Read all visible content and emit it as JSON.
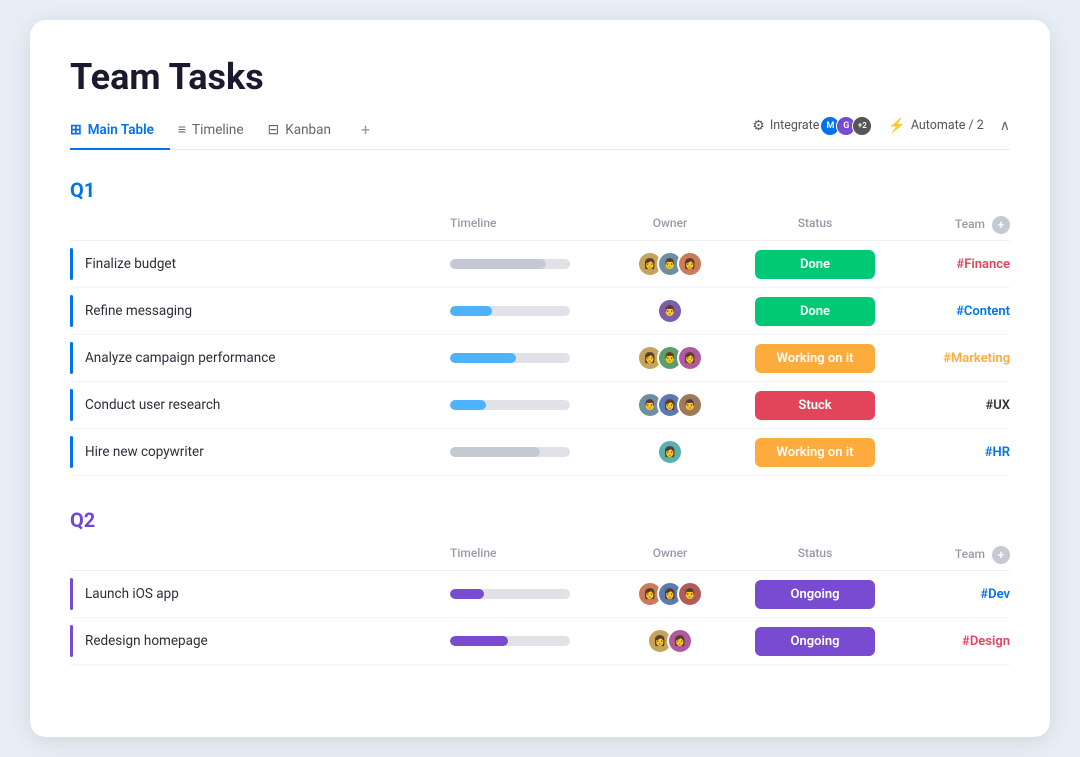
{
  "page": {
    "title": "Team Tasks"
  },
  "tabs": [
    {
      "id": "main-table",
      "label": "Main Table",
      "icon": "⊞",
      "active": true
    },
    {
      "id": "timeline",
      "label": "Timeline",
      "icon": "≡",
      "active": false
    },
    {
      "id": "kanban",
      "label": "Kanban",
      "icon": "⊟",
      "active": false
    },
    {
      "id": "plus",
      "label": "+",
      "active": false
    }
  ],
  "toolbar": {
    "integrate_label": "Integrate",
    "automate_label": "Automate / 2",
    "chevron_label": "^"
  },
  "sections": [
    {
      "id": "q1",
      "label": "Q1",
      "color_class": "q1",
      "columns": {
        "task": "",
        "timeline": "Timeline",
        "owner": "Owner",
        "status": "Status",
        "team": "Team"
      },
      "rows": [
        {
          "id": "finalize-budget",
          "name": "Finalize budget",
          "bar_color": "#0073ea",
          "timeline_fill_pct": 80,
          "timeline_fill_color": "#c5c9d4",
          "timeline_offset": 0,
          "avatars": [
            "av1",
            "av2",
            "av3"
          ],
          "status": "Done",
          "status_class": "status-done",
          "team": "#Finance",
          "team_class": "team-finance"
        },
        {
          "id": "refine-messaging",
          "name": "Refine messaging",
          "bar_color": "#0073ea",
          "timeline_fill_pct": 35,
          "timeline_fill_color": "#4db3ff",
          "timeline_offset": 0,
          "avatars": [
            "av4"
          ],
          "status": "Done",
          "status_class": "status-done",
          "team": "#Content",
          "team_class": "team-content"
        },
        {
          "id": "analyze-campaign",
          "name": "Analyze campaign performance",
          "bar_color": "#0073ea",
          "timeline_fill_pct": 55,
          "timeline_fill_color": "#4db3ff",
          "timeline_offset": 0,
          "avatars": [
            "av1",
            "av5",
            "av6"
          ],
          "status": "Working on it",
          "status_class": "status-working",
          "team": "#Marketing",
          "team_class": "team-marketing"
        },
        {
          "id": "conduct-user-research",
          "name": "Conduct user research",
          "bar_color": "#0073ea",
          "timeline_fill_pct": 30,
          "timeline_fill_color": "#4db3ff",
          "timeline_offset": 0,
          "avatars": [
            "av2",
            "av7",
            "av8"
          ],
          "status": "Stuck",
          "status_class": "status-stuck",
          "team": "#UX",
          "team_class": "team-ux"
        },
        {
          "id": "hire-copywriter",
          "name": "Hire new copywriter",
          "bar_color": "#0073ea",
          "timeline_fill_pct": 75,
          "timeline_fill_color": "#c5c9d4",
          "timeline_offset": 0,
          "avatars": [
            "av9"
          ],
          "status": "Working on it",
          "status_class": "status-working",
          "team": "#HR",
          "team_class": "team-hr"
        }
      ]
    },
    {
      "id": "q2",
      "label": "Q2",
      "color_class": "q2",
      "columns": {
        "task": "",
        "timeline": "Timeline",
        "owner": "Owner",
        "status": "Status",
        "team": "Team"
      },
      "rows": [
        {
          "id": "launch-ios",
          "name": "Launch iOS app",
          "bar_color": "#784bd1",
          "timeline_fill_pct": 28,
          "timeline_fill_color": "#784bd1",
          "timeline_offset": 0,
          "avatars": [
            "av3",
            "av7",
            "av10"
          ],
          "status": "Ongoing",
          "status_class": "status-ongoing",
          "team": "#Dev",
          "team_class": "team-dev"
        },
        {
          "id": "redesign-homepage",
          "name": "Redesign homepage",
          "bar_color": "#784bd1",
          "timeline_fill_pct": 48,
          "timeline_fill_color": "#784bd1",
          "timeline_offset": 0,
          "avatars": [
            "av1",
            "av6"
          ],
          "status": "Ongoing",
          "status_class": "status-ongoing",
          "team": "#Design",
          "team_class": "team-design"
        }
      ]
    }
  ]
}
